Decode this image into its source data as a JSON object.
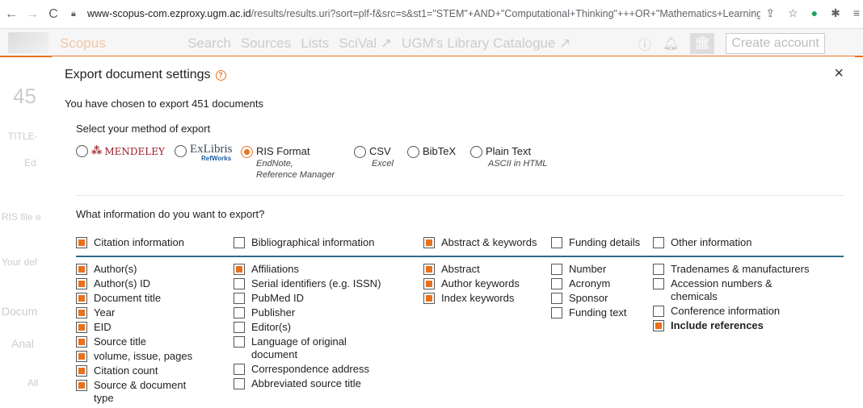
{
  "browser": {
    "url_host": "www-scopus-com.ezproxy.ugm.ac.id",
    "url_path": "/results/results.uri?sort=plf-f&src=s&st1=\"STEM\"+AND+\"Computational+Thinking\"+++OR+\"Mathematics+Learning\"&s..."
  },
  "scopus": {
    "brand": "Scopus",
    "nav": [
      "Search",
      "Sources",
      "Lists",
      "SciVal ↗",
      "UGM's Library Catalogue ↗"
    ],
    "create_account": "Create account",
    "behind_fragments": [
      "45",
      "TITLE-",
      "Ed",
      "RIS file e",
      "Your def",
      "Docum",
      "Anal",
      "All"
    ]
  },
  "modal": {
    "title": "Export document settings",
    "close": "×",
    "subtitle": "You have chosen to export 451 documents",
    "method_label": "Select your method of export",
    "methods": [
      {
        "label": "MENDELEY",
        "selected": false
      },
      {
        "label": "ExLibris",
        "sub": "RefWorks",
        "selected": false
      },
      {
        "label": "RIS Format",
        "sub1": "EndNote,",
        "sub2": "Reference Manager",
        "selected": true
      },
      {
        "label": "CSV",
        "sub1": "Excel",
        "selected": false
      },
      {
        "label": "BibTeX",
        "selected": false
      },
      {
        "label": "Plain Text",
        "sub1": "ASCII in HTML",
        "selected": false
      }
    ],
    "info_label": "What information do you want to export?",
    "categories": [
      {
        "label": "Citation information",
        "checked": true
      },
      {
        "label": "Bibliographical information",
        "checked": false
      },
      {
        "label": "Abstract & keywords",
        "checked": true
      },
      {
        "label": "Funding details",
        "checked": false
      },
      {
        "label": "Other information",
        "checked": false
      }
    ],
    "columns": [
      [
        {
          "label": "Author(s)",
          "checked": true
        },
        {
          "label": "Author(s) ID",
          "checked": true
        },
        {
          "label": "Document title",
          "checked": true
        },
        {
          "label": "Year",
          "checked": true
        },
        {
          "label": "EID",
          "checked": true
        },
        {
          "label": "Source title",
          "checked": true
        },
        {
          "label": "volume, issue, pages",
          "checked": true
        },
        {
          "label": "Citation count",
          "checked": true
        },
        {
          "label": "Source & document type",
          "checked": true
        }
      ],
      [
        {
          "label": "Affiliations",
          "checked": true
        },
        {
          "label": "Serial identifiers (e.g. ISSN)",
          "checked": false
        },
        {
          "label": "PubMed ID",
          "checked": false
        },
        {
          "label": "Publisher",
          "checked": false
        },
        {
          "label": "Editor(s)",
          "checked": false
        },
        {
          "label": "Language of original document",
          "checked": false
        },
        {
          "label": "Correspondence address",
          "checked": false
        },
        {
          "label": "Abbreviated source title",
          "checked": false
        }
      ],
      [
        {
          "label": "Abstract",
          "checked": true
        },
        {
          "label": "Author keywords",
          "checked": true
        },
        {
          "label": "Index keywords",
          "checked": true
        }
      ],
      [
        {
          "label": "Number",
          "checked": false
        },
        {
          "label": "Acronym",
          "checked": false
        },
        {
          "label": "Sponsor",
          "checked": false
        },
        {
          "label": "Funding text",
          "checked": false
        }
      ],
      [
        {
          "label": "Tradenames & manufacturers",
          "checked": false
        },
        {
          "label": "Accession numbers & chemicals",
          "checked": false
        },
        {
          "label": "Conference information",
          "checked": false
        },
        {
          "label": "Include references",
          "checked": true
        }
      ]
    ]
  }
}
